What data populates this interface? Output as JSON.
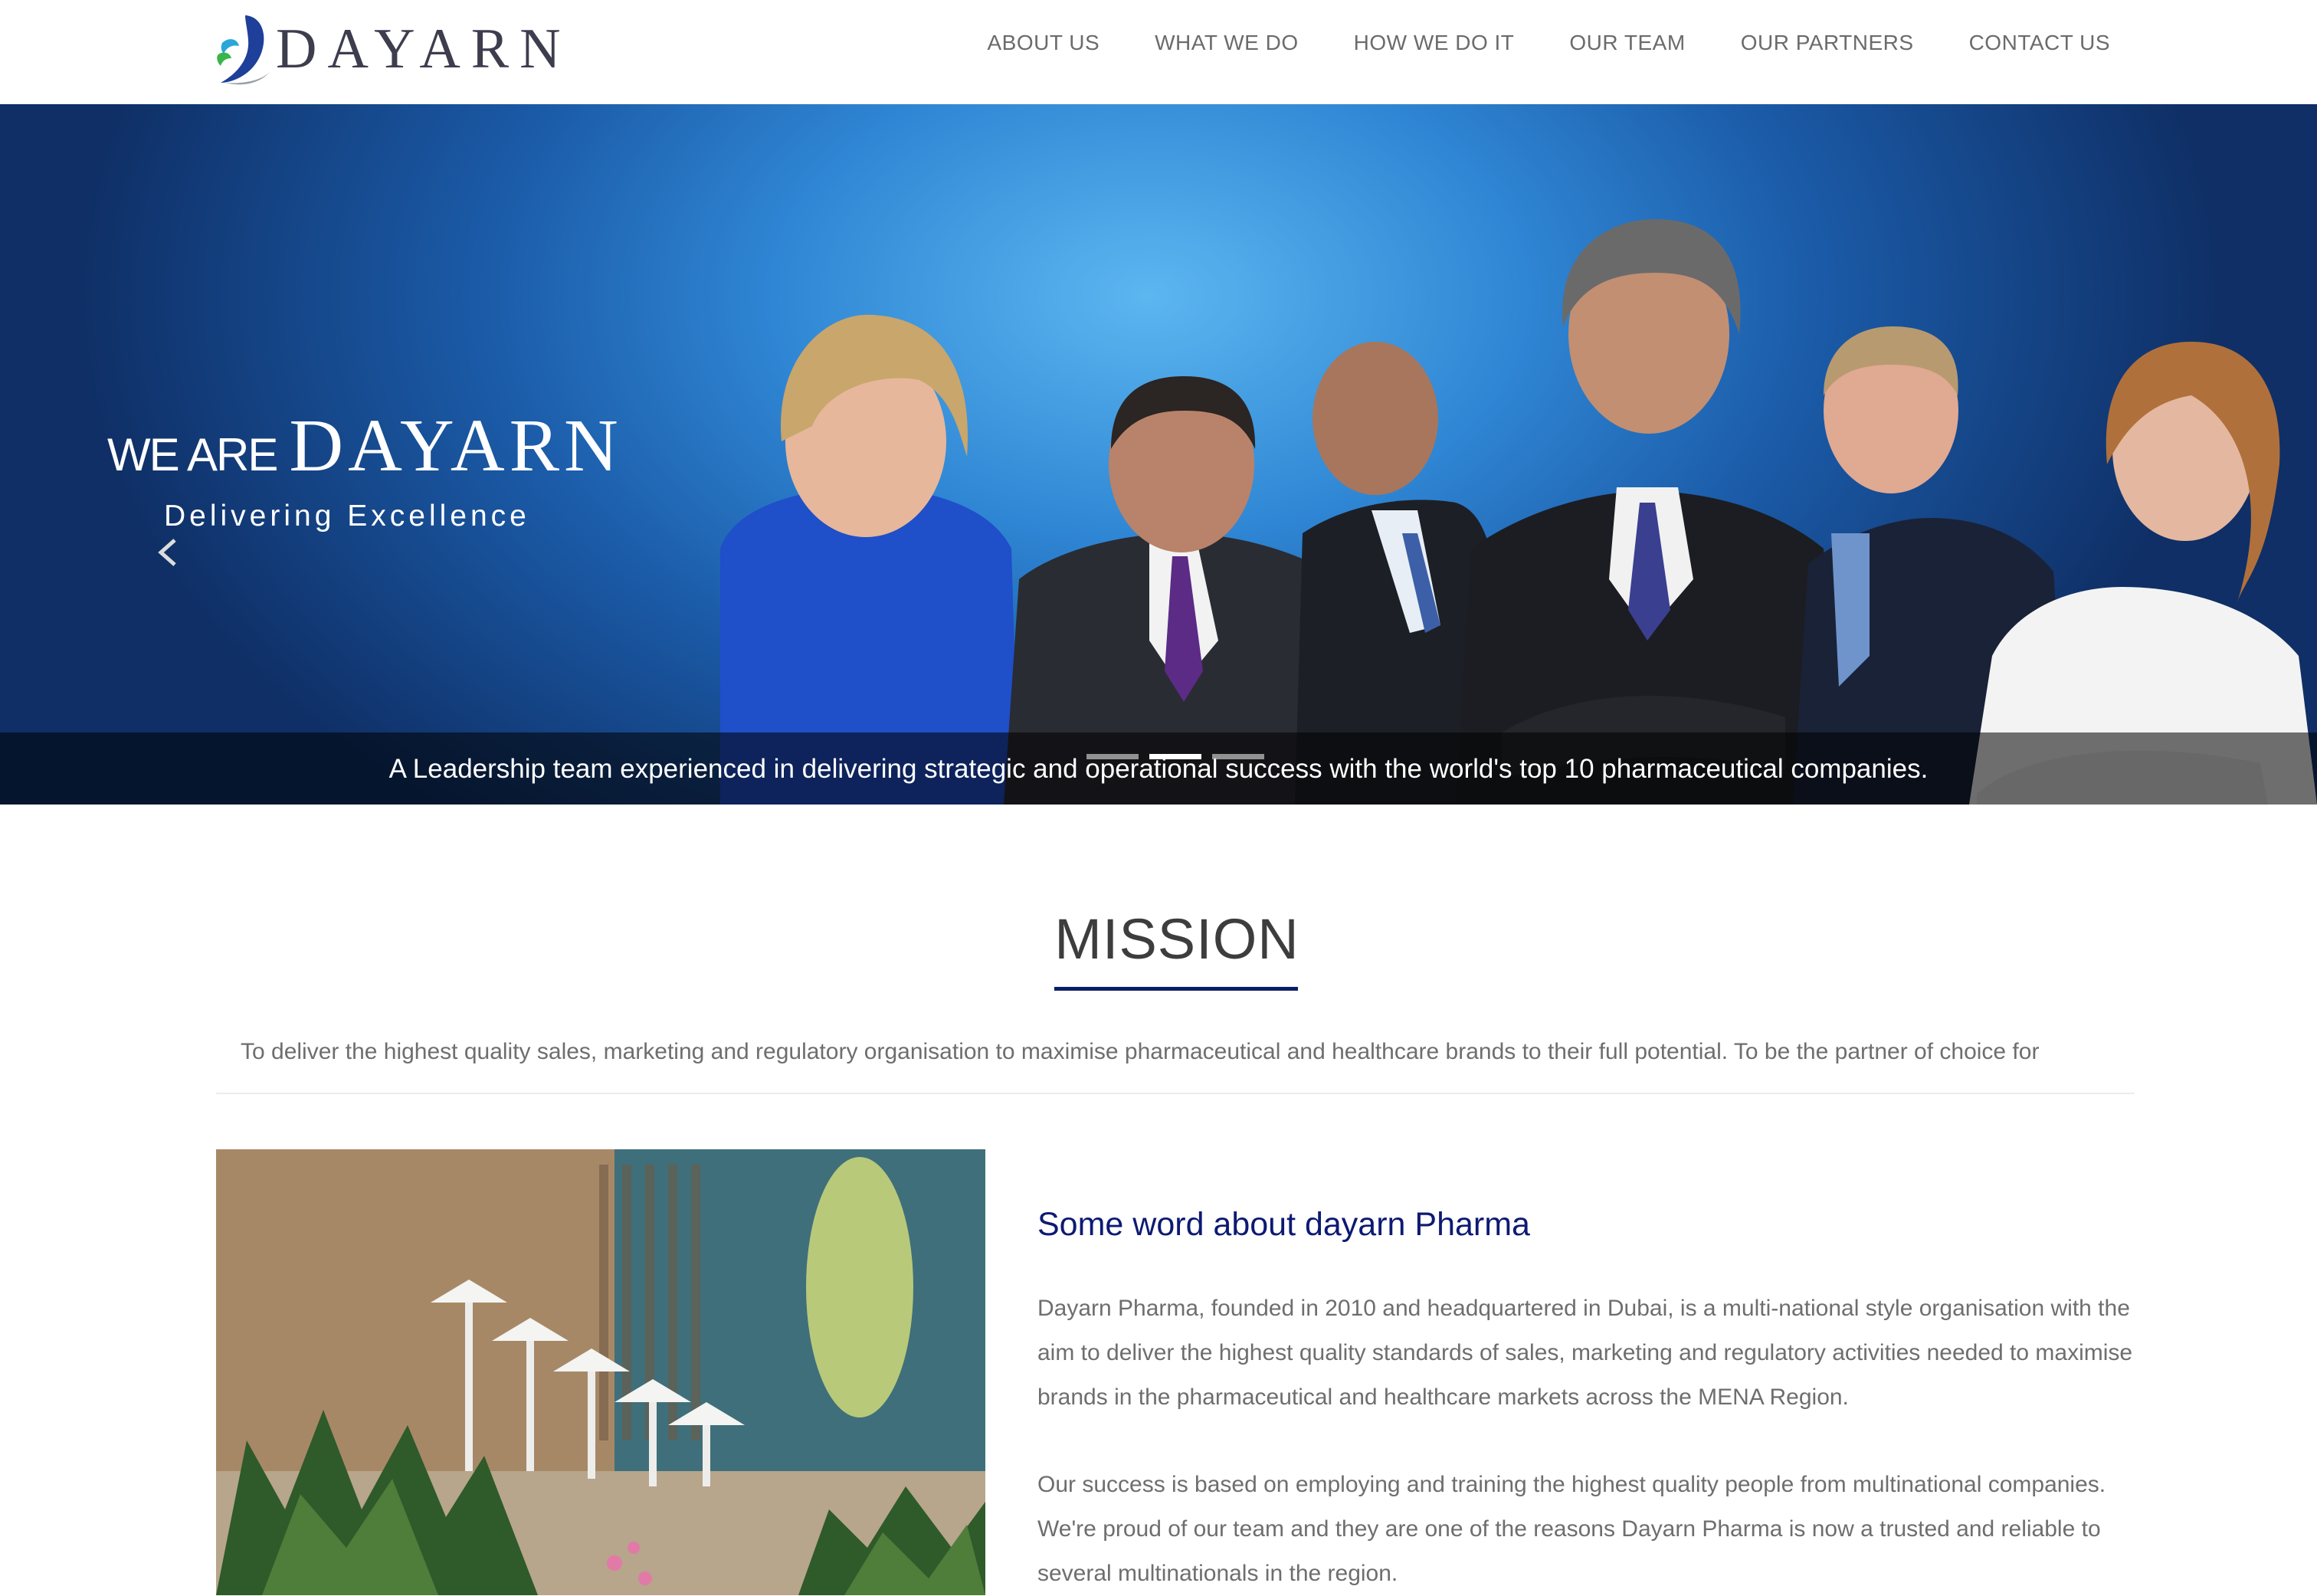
{
  "brand": {
    "name": "DAYARN"
  },
  "nav": {
    "items": [
      "ABOUT US",
      "WHAT WE DO",
      "HOW WE DO IT",
      "OUR TEAM",
      "OUR PARTNERS",
      "CONTACT US"
    ]
  },
  "hero": {
    "title_prefix": "WE ARE",
    "title_brand": "DAYARN",
    "subtitle": "Delivering Excellence",
    "caption": "A Leadership team experienced in delivering strategic and operational success with the world's top 10 pharmaceutical companies.",
    "slide_count": 3,
    "active_slide": 2
  },
  "mission": {
    "title": "MISSION",
    "text": "To deliver the highest quality sales, marketing and regulatory organisation to maximise pharmaceutical and healthcare brands to their full potential. To be the partner of choice for"
  },
  "about": {
    "heading": "Some word about dayarn Pharma",
    "paragraphs": [
      "Dayarn Pharma, founded in 2010 and headquartered in Dubai, is a multi-national style organisation with the aim to deliver the highest quality standards of sales, marketing and regulatory activities needed to maximise brands in the pharmaceutical and healthcare markets across the MENA Region.",
      "Our success is based on employing and training the highest quality people from multinational companies. We're proud of our team and they are one of the reasons Dayarn Pharma is now a trusted and reliable to several multinationals in the region."
    ]
  },
  "colors": {
    "accent_navy": "#0b1f66",
    "heading_blue": "#0d1a73",
    "nav_text": "#6b6b6b",
    "body_text": "#6e6e6e"
  },
  "icons": {
    "logo": "dayarn-swoosh-logo-icon",
    "slider_prev": "chevron-left-icon"
  }
}
